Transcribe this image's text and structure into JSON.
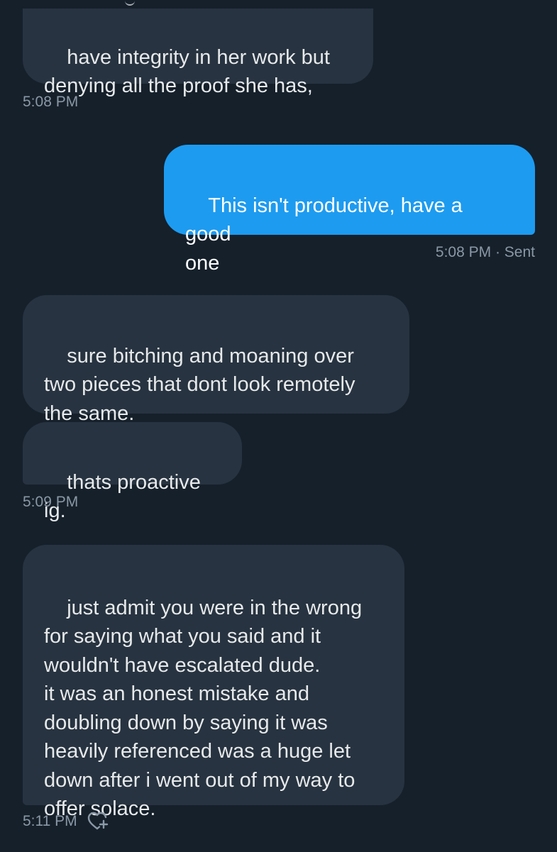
{
  "messages": [
    {
      "direction": "received",
      "text": "have integrity in her work but\ndenying all the proof she has,"
    },
    {
      "direction": "sent",
      "text": "This isn't productive, have a good\none"
    },
    {
      "direction": "received",
      "text": "sure bitching and moaning over\ntwo pieces that dont look remotely\nthe same."
    },
    {
      "direction": "received",
      "text": "thats proactive ig."
    },
    {
      "direction": "received",
      "text": "just admit you were in the wrong\nfor saying what you said and it\nwouldn't have escalated dude.\nit was an honest mistake and\ndoubling down by saying it was\nheavily referenced was a huge let\ndown after i went out of my way to\noffer solace."
    }
  ],
  "timestamps": {
    "t1": "5:08 PM",
    "t2": "5:08 PM · Sent",
    "t3": "5:09 PM",
    "t4": "5:11 PM"
  },
  "icons": {
    "reaction": "add-reaction-heart-icon"
  },
  "colors": {
    "background": "#15202b",
    "received_bubble": "#273340",
    "sent_bubble": "#1d9bf0",
    "text": "#e7e9ea",
    "meta_text": "#8b98a5"
  }
}
